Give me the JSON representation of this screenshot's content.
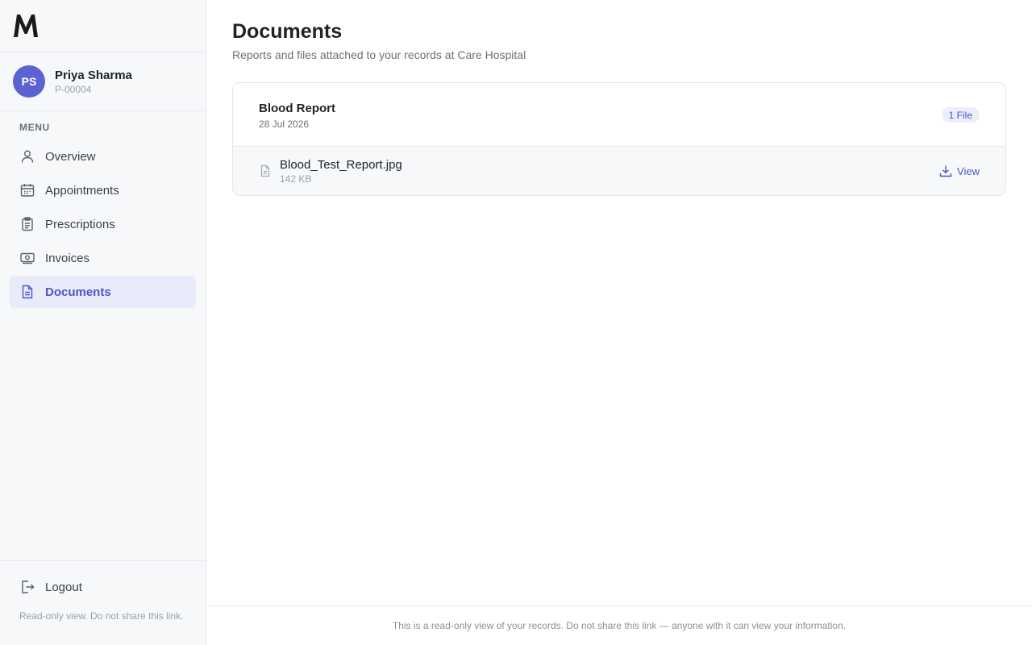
{
  "app": {
    "logo_icon": "m-logo-icon"
  },
  "profile": {
    "initials": "PS",
    "name": "Priya Sharma",
    "patient_id": "P-00004",
    "avatar_color": "#5b63d3"
  },
  "sidebar": {
    "menu_label": "MENU",
    "items": [
      {
        "label": "Overview",
        "icon": "user-icon",
        "active": false
      },
      {
        "label": "Appointments",
        "icon": "calendar-icon",
        "active": false
      },
      {
        "label": "Prescriptions",
        "icon": "clipboard-icon",
        "active": false
      },
      {
        "label": "Invoices",
        "icon": "banknote-icon",
        "active": false
      },
      {
        "label": "Documents",
        "icon": "document-icon",
        "active": true
      }
    ],
    "logout_label": "Logout",
    "readonly_note": "Read-only view. Do not share this link."
  },
  "page": {
    "title": "Documents",
    "subtitle": "Reports and files attached to your records at Care Hospital"
  },
  "documents": [
    {
      "title": "Blood Report",
      "date": "28 Jul 2026",
      "badge": "1 File",
      "files": [
        {
          "name": "Blood_Test_Report.jpg",
          "size": "142 KB",
          "action": "View"
        }
      ]
    }
  ],
  "footer": {
    "text": "This is a read-only view of your records. Do not share this link — anyone with it can view your information."
  },
  "colors": {
    "accent": "#4c55c9",
    "active_bg": "#e9ebfb",
    "sidebar_bg": "#f7f8fa"
  }
}
